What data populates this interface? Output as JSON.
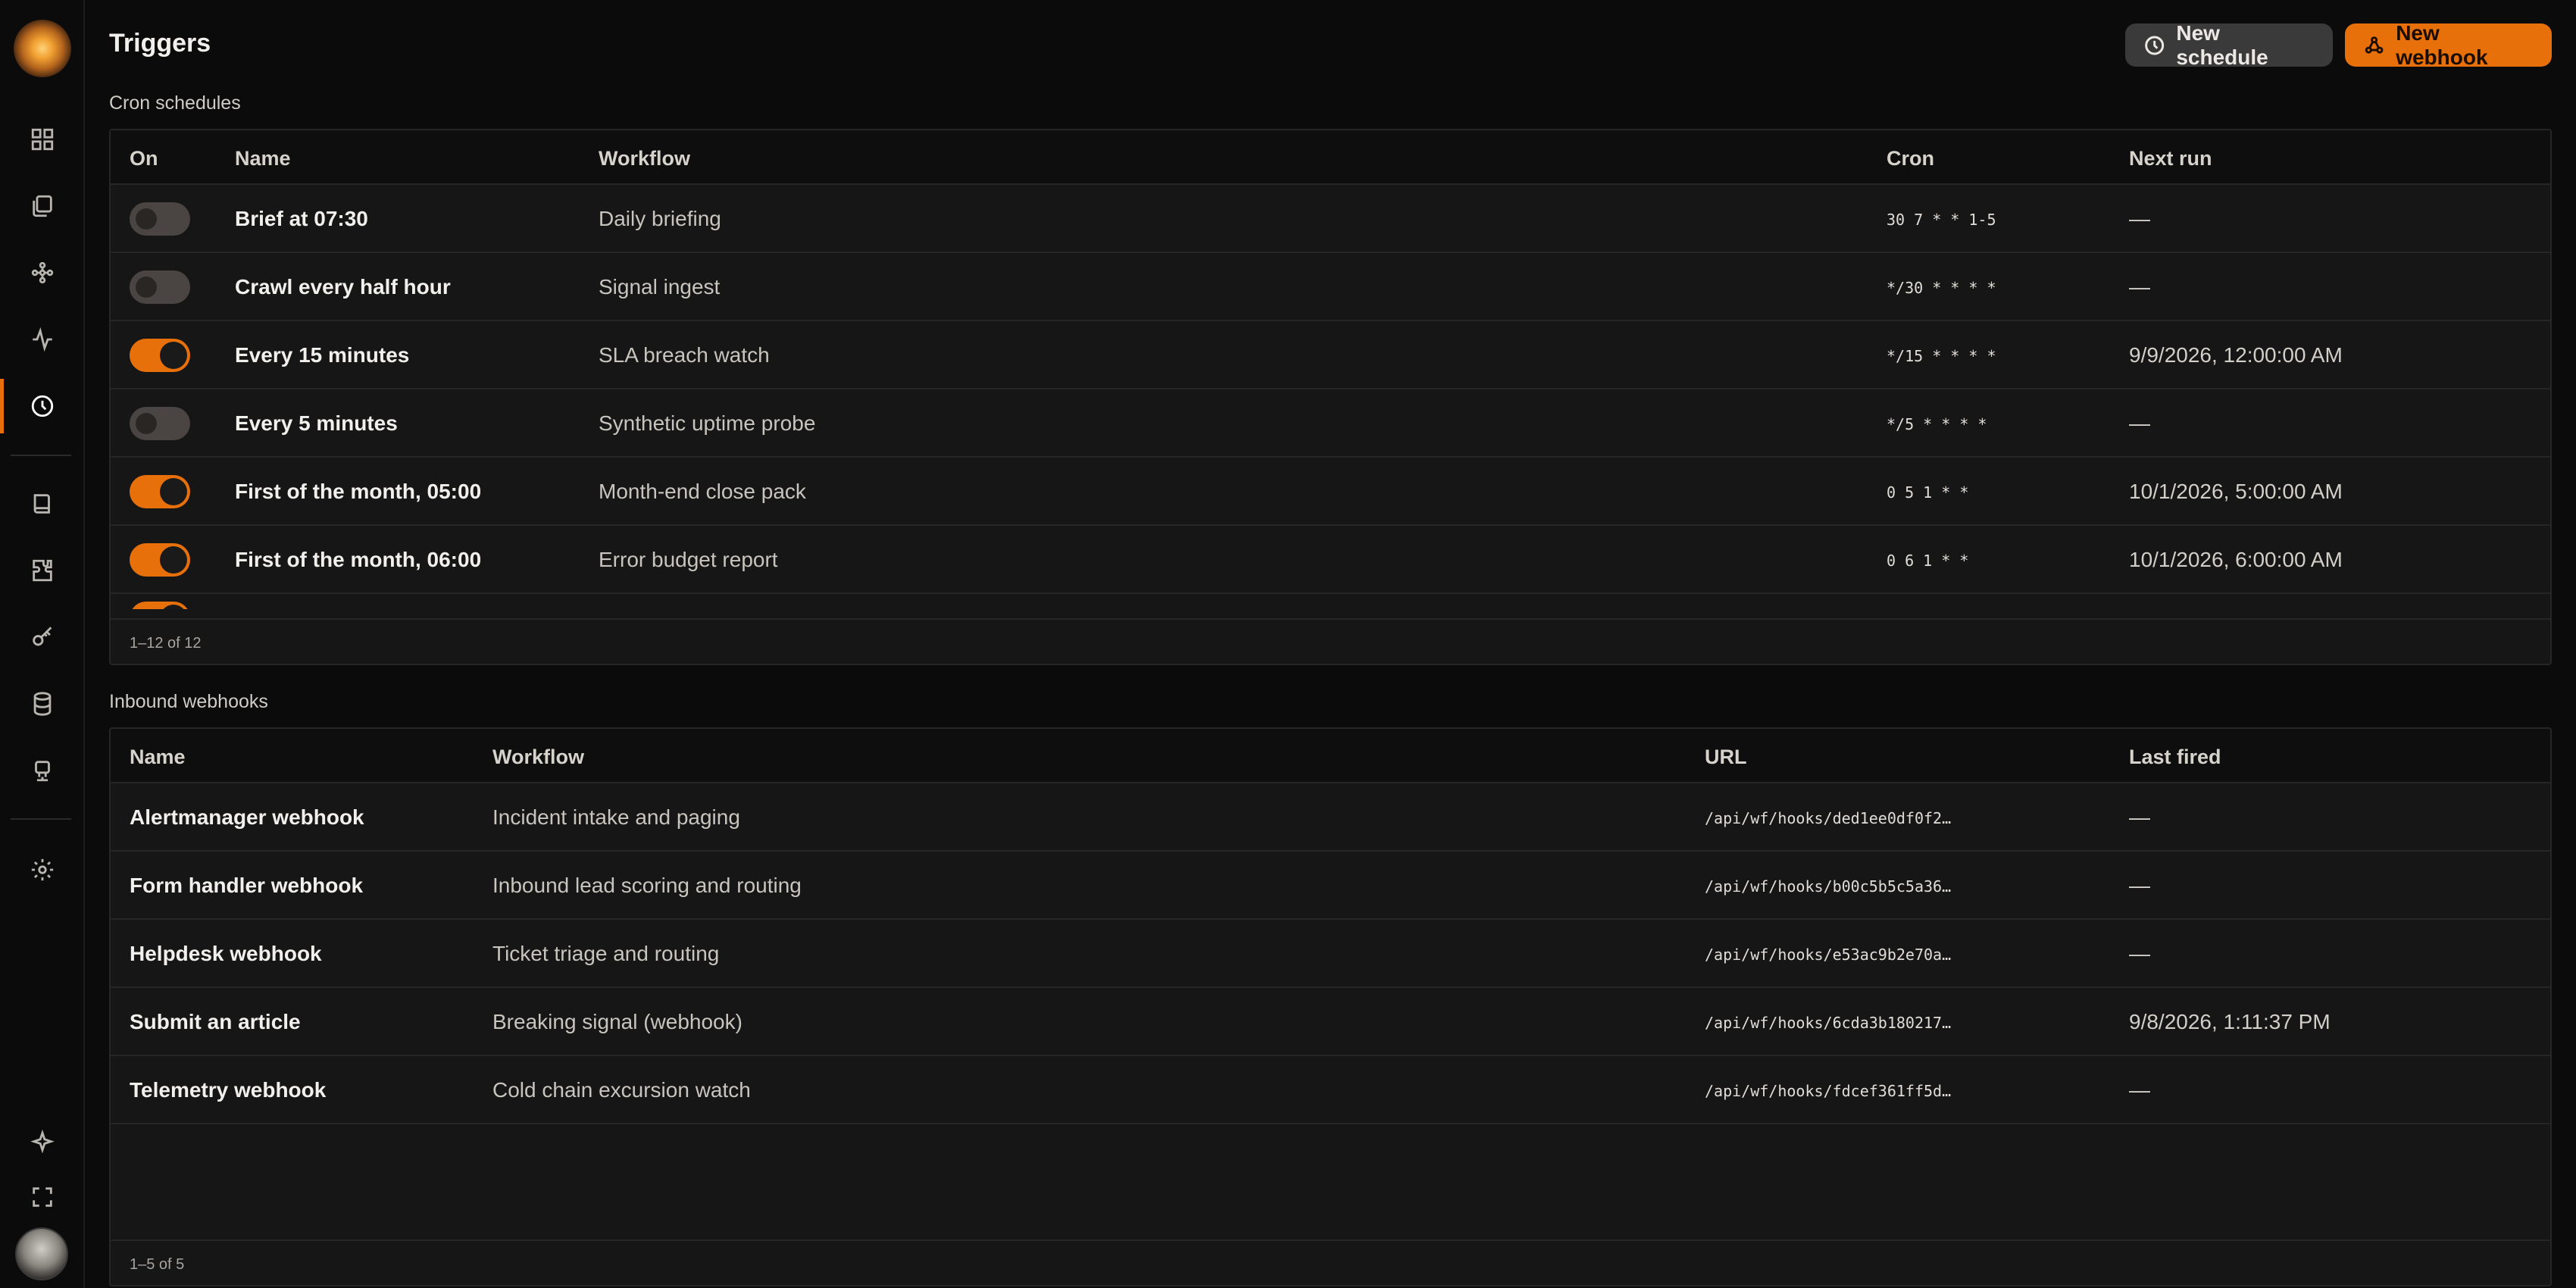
{
  "header": {
    "title": "Triggers",
    "new_schedule_label": "New schedule",
    "new_webhook_label": "New webhook"
  },
  "colors": {
    "accent": "#e8700a",
    "background": "#0b0b0b",
    "panel": "#161616"
  },
  "sidebar": {
    "icons": [
      "dashboard-icon",
      "files-icon",
      "graph-icon",
      "activity-icon",
      "clock-icon",
      "book-icon",
      "puzzle-icon",
      "key-icon",
      "database-icon",
      "robot-icon",
      "gear-icon",
      "sparkle-icon",
      "fullscreen-icon"
    ],
    "active": "clock-icon"
  },
  "cron": {
    "section_label": "Cron schedules",
    "columns": {
      "on": "On",
      "name": "Name",
      "workflow": "Workflow",
      "cron": "Cron",
      "next_run": "Next run"
    },
    "rows": [
      {
        "on": false,
        "name": "Brief at 07:30",
        "workflow": "Daily briefing",
        "cron": "30 7 * * 1-5",
        "next_run": "—"
      },
      {
        "on": false,
        "name": "Crawl every half hour",
        "workflow": "Signal ingest",
        "cron": "*/30 * * * *",
        "next_run": "—"
      },
      {
        "on": true,
        "name": "Every 15 minutes",
        "workflow": "SLA breach watch",
        "cron": "*/15 * * * *",
        "next_run": "9/9/2026, 12:00:00 AM"
      },
      {
        "on": false,
        "name": "Every 5 minutes",
        "workflow": "Synthetic uptime probe",
        "cron": "*/5 * * * *",
        "next_run": "—"
      },
      {
        "on": true,
        "name": "First of the month, 05:00",
        "workflow": "Month-end close pack",
        "cron": "0 5 1 * *",
        "next_run": "10/1/2026, 5:00:00 AM"
      },
      {
        "on": true,
        "name": "First of the month, 06:00",
        "workflow": "Error budget report",
        "cron": "0 6 1 * *",
        "next_run": "10/1/2026, 6:00:00 AM"
      }
    ],
    "footer": "1–12 of 12"
  },
  "webhooks": {
    "section_label": "Inbound webhooks",
    "columns": {
      "name": "Name",
      "workflow": "Workflow",
      "url": "URL",
      "last_fired": "Last fired"
    },
    "rows": [
      {
        "name": "Alertmanager webhook",
        "workflow": "Incident intake and paging",
        "url": "/api/wf/hooks/ded1ee0df0f2…",
        "last_fired": "—"
      },
      {
        "name": "Form handler webhook",
        "workflow": "Inbound lead scoring and routing",
        "url": "/api/wf/hooks/b00c5b5c5a36…",
        "last_fired": "—"
      },
      {
        "name": "Helpdesk webhook",
        "workflow": "Ticket triage and routing",
        "url": "/api/wf/hooks/e53ac9b2e70a…",
        "last_fired": "—"
      },
      {
        "name": "Submit an article",
        "workflow": "Breaking signal (webhook)",
        "url": "/api/wf/hooks/6cda3b180217…",
        "last_fired": "9/8/2026, 1:11:37 PM"
      },
      {
        "name": "Telemetry webhook",
        "workflow": "Cold chain excursion watch",
        "url": "/api/wf/hooks/fdcef361ff5d…",
        "last_fired": "—"
      }
    ],
    "footer": "1–5 of 5"
  }
}
